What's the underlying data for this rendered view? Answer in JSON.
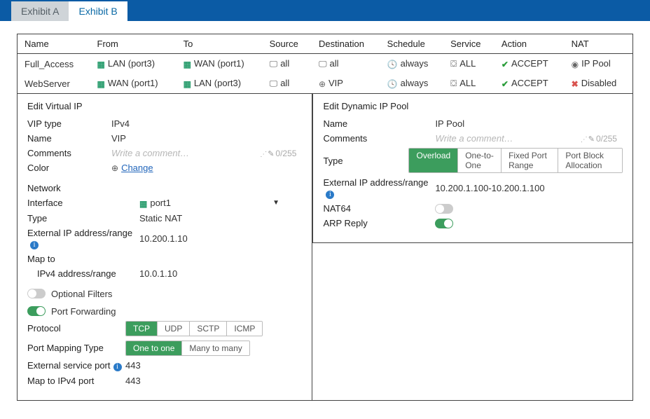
{
  "tabs": {
    "a": "Exhibit A",
    "b": "Exhibit B"
  },
  "policy_table": {
    "headers": {
      "name": "Name",
      "from": "From",
      "to": "To",
      "source": "Source",
      "destination": "Destination",
      "schedule": "Schedule",
      "service": "Service",
      "action": "Action",
      "nat": "NAT"
    },
    "rows": [
      {
        "name": "Full_Access",
        "from": "LAN (port3)",
        "to": "WAN (port1)",
        "source": "all",
        "destination": "all",
        "schedule": "always",
        "service": "ALL",
        "action": "ACCEPT",
        "nat": "IP Pool",
        "nat_icon": "ippool"
      },
      {
        "name": "WebServer",
        "from": "WAN (port1)",
        "to": "LAN (port3)",
        "source": "all",
        "destination": "VIP",
        "schedule": "always",
        "service": "ALL",
        "action": "ACCEPT",
        "nat": "Disabled",
        "nat_icon": "disabled"
      }
    ]
  },
  "vip": {
    "title": "Edit Virtual IP",
    "vip_type_label": "VIP type",
    "vip_type": "IPv4",
    "name_label": "Name",
    "name": "VIP",
    "comments_label": "Comments",
    "comments_placeholder": "Write a comment…",
    "comments_counter": "0/255",
    "color_label": "Color",
    "color_change": "Change",
    "network_heading": "Network",
    "interface_label": "Interface",
    "interface": "port1",
    "type_label": "Type",
    "type": "Static NAT",
    "ext_ip_label": "External IP address/range",
    "ext_ip": "10.200.1.10",
    "map_to_label": "Map to",
    "ipv4_range_label": "IPv4 address/range",
    "ipv4_range": "10.0.1.10",
    "optional_filters_label": "Optional Filters",
    "port_forwarding_label": "Port Forwarding",
    "protocol_label": "Protocol",
    "protocols": {
      "tcp": "TCP",
      "udp": "UDP",
      "sctp": "SCTP",
      "icmp": "ICMP"
    },
    "port_mapping_label": "Port Mapping Type",
    "port_mapping": {
      "one": "One to one",
      "many": "Many to many"
    },
    "ext_port_label": "External service port",
    "ext_port": "443",
    "map_port_label": "Map to IPv4 port",
    "map_port": "443"
  },
  "pool": {
    "title": "Edit Dynamic IP Pool",
    "name_label": "Name",
    "name": "IP Pool",
    "comments_label": "Comments",
    "comments_placeholder": "Write a comment…",
    "comments_counter": "0/255",
    "type_label": "Type",
    "types": {
      "overload": "Overload",
      "oto": "One-to-One",
      "fpr": "Fixed Port Range",
      "pba": "Port Block Allocation"
    },
    "ext_ip_label": "External IP address/range",
    "ext_ip": "10.200.1.100-10.200.1.100",
    "nat64_label": "NAT64",
    "arp_label": "ARP Reply"
  }
}
